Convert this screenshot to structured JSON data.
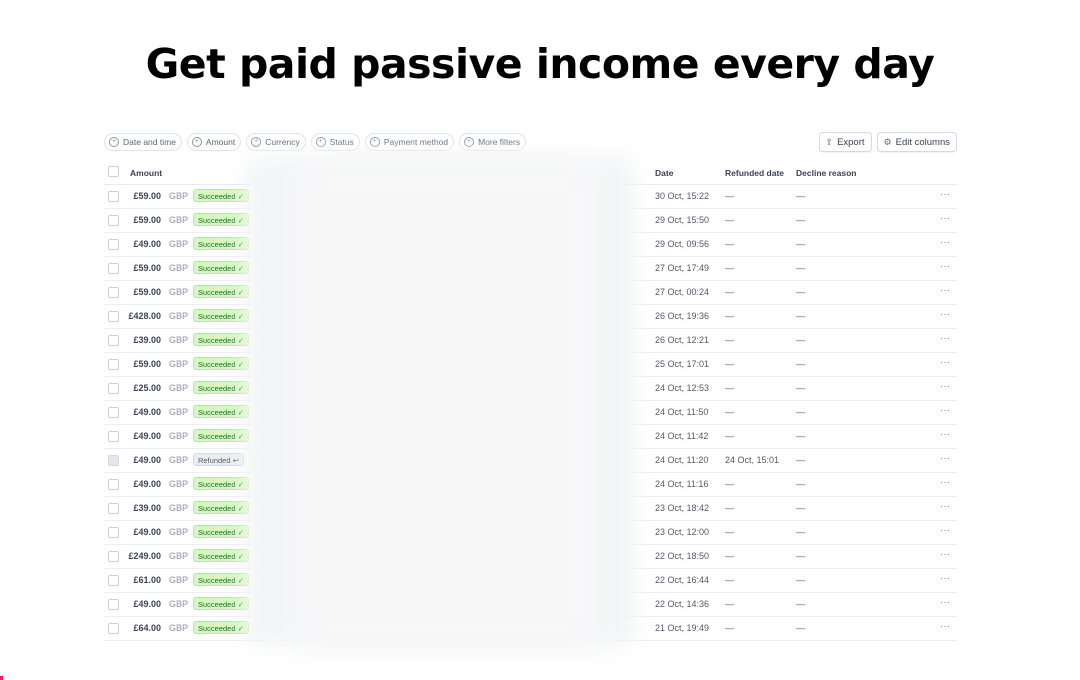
{
  "headline": "Get paid passive income every day",
  "filters": [
    {
      "label": "Date and time"
    },
    {
      "label": "Amount"
    },
    {
      "label": "Currency"
    },
    {
      "label": "Status"
    },
    {
      "label": "Payment method"
    },
    {
      "label": "More filters"
    }
  ],
  "toolbar": {
    "export_label": "Export",
    "edit_columns_label": "Edit columns"
  },
  "columns": {
    "amount": "Amount",
    "date": "Date",
    "refunded_date": "Refunded date",
    "decline_reason": "Decline reason"
  },
  "colors": {
    "succeeded_bg": "#d7f7c2",
    "succeeded_text": "#1f6f1f",
    "refunded_bg": "#ebeef1"
  },
  "rows": [
    {
      "amount": "£59.00",
      "currency": "GBP",
      "status": "Succeeded",
      "date": "30 Oct, 15:22",
      "refunded": "—",
      "decline": "—"
    },
    {
      "amount": "£59.00",
      "currency": "GBP",
      "status": "Succeeded",
      "date": "29 Oct, 15:50",
      "refunded": "—",
      "decline": "—"
    },
    {
      "amount": "£49.00",
      "currency": "GBP",
      "status": "Succeeded",
      "date": "29 Oct, 09:56",
      "refunded": "—",
      "decline": "—"
    },
    {
      "amount": "£59.00",
      "currency": "GBP",
      "status": "Succeeded",
      "date": "27 Oct, 17:49",
      "refunded": "—",
      "decline": "—"
    },
    {
      "amount": "£59.00",
      "currency": "GBP",
      "status": "Succeeded",
      "date": "27 Oct, 00:24",
      "refunded": "—",
      "decline": "—"
    },
    {
      "amount": "£428.00",
      "currency": "GBP",
      "status": "Succeeded",
      "date": "26 Oct, 19:36",
      "refunded": "—",
      "decline": "—"
    },
    {
      "amount": "£39.00",
      "currency": "GBP",
      "status": "Succeeded",
      "date": "26 Oct, 12:21",
      "refunded": "—",
      "decline": "—"
    },
    {
      "amount": "£59.00",
      "currency": "GBP",
      "status": "Succeeded",
      "date": "25 Oct, 17:01",
      "refunded": "—",
      "decline": "—"
    },
    {
      "amount": "£25.00",
      "currency": "GBP",
      "status": "Succeeded",
      "date": "24 Oct, 12:53",
      "refunded": "—",
      "decline": "—"
    },
    {
      "amount": "£49.00",
      "currency": "GBP",
      "status": "Succeeded",
      "date": "24 Oct, 11:50",
      "refunded": "—",
      "decline": "—"
    },
    {
      "amount": "£49.00",
      "currency": "GBP",
      "status": "Succeeded",
      "date": "24 Oct, 11:42",
      "refunded": "—",
      "decline": "—"
    },
    {
      "amount": "£49.00",
      "currency": "GBP",
      "status": "Refunded",
      "date": "24 Oct, 11:20",
      "refunded": "24 Oct, 15:01",
      "decline": "—"
    },
    {
      "amount": "£49.00",
      "currency": "GBP",
      "status": "Succeeded",
      "date": "24 Oct, 11:16",
      "refunded": "—",
      "decline": "—"
    },
    {
      "amount": "£39.00",
      "currency": "GBP",
      "status": "Succeeded",
      "date": "23 Oct, 18:42",
      "refunded": "—",
      "decline": "—"
    },
    {
      "amount": "£49.00",
      "currency": "GBP",
      "status": "Succeeded",
      "date": "23 Oct, 12:00",
      "refunded": "—",
      "decline": "—"
    },
    {
      "amount": "£249.00",
      "currency": "GBP",
      "status": "Succeeded",
      "date": "22 Oct, 18:50",
      "refunded": "—",
      "decline": "—"
    },
    {
      "amount": "£61.00",
      "currency": "GBP",
      "status": "Succeeded",
      "date": "22 Oct, 16:44",
      "refunded": "—",
      "decline": "—"
    },
    {
      "amount": "£49.00",
      "currency": "GBP",
      "status": "Succeeded",
      "date": "22 Oct, 14:36",
      "refunded": "—",
      "decline": "—"
    },
    {
      "amount": "£64.00",
      "currency": "GBP",
      "status": "Succeeded",
      "date": "21 Oct, 19:49",
      "refunded": "—",
      "decline": "—"
    }
  ]
}
